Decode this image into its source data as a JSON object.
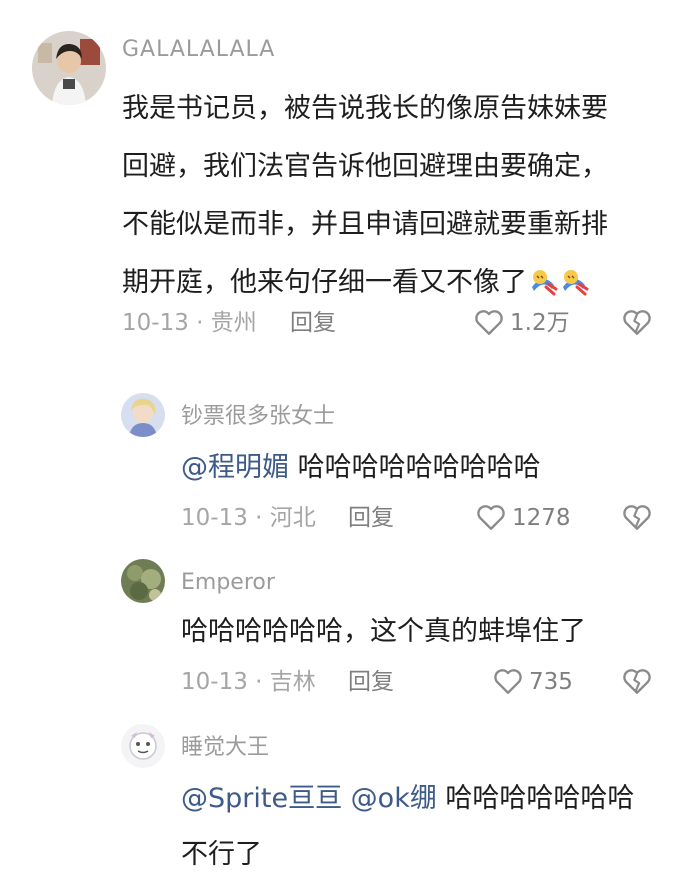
{
  "comments": [
    {
      "username": "GALALALALA",
      "lines": [
        "我是书记员，被告说我长的像原告妹妹要",
        "回避，我们法官告诉他回避理由要确定，",
        "不能似是而非，并且申请回避就要重新排",
        "期开庭，他来句仔细一看又不像了"
      ],
      "emoji_icons": [
        "falling-person-emoji",
        "falling-person-emoji"
      ],
      "date": "10-13",
      "location": "贵州",
      "reply_label": "回复",
      "likes": "1.2万"
    },
    {
      "username": "钞票很多张女士",
      "mention": "@程明媚",
      "text": "哈哈哈哈哈哈哈哈哈",
      "date": "10-13",
      "location": "河北",
      "reply_label": "回复",
      "likes": "1278"
    },
    {
      "username": "Emperor",
      "text": "哈哈哈哈哈哈，这个真的蚌埠住了",
      "date": "10-13",
      "location": "吉林",
      "reply_label": "回复",
      "likes": "735"
    },
    {
      "username": "睡觉大王",
      "mentions": [
        "@Sprite亘亘",
        "@ok绷"
      ],
      "text": "哈哈哈哈哈哈哈",
      "text_line2": "不行了"
    }
  ],
  "meta_separator": " · ",
  "icons": [
    "heart-outline-icon",
    "broken-heart-icon"
  ],
  "colors": {
    "mention": "#3d5a8a",
    "text": "#1e1e1e",
    "meta": "#a5a5a5",
    "icon": "#8a8a8a"
  }
}
